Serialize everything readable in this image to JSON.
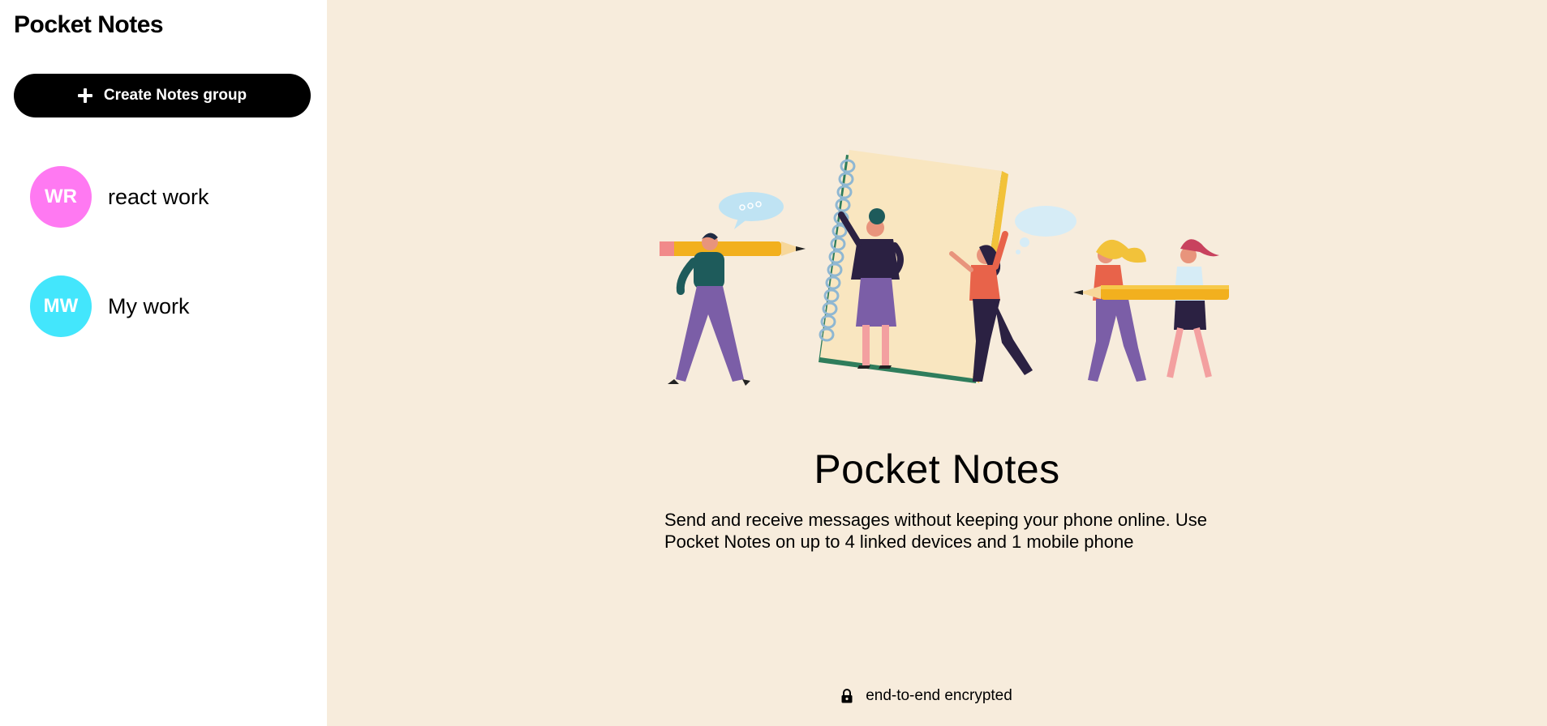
{
  "sidebar": {
    "title": "Pocket Notes",
    "create_button_label": "Create Notes group",
    "groups": [
      {
        "initials": "WR",
        "name": "react work",
        "color": "#ff79f2"
      },
      {
        "initials": "MW",
        "name": "My work",
        "color": "#43e6fc"
      }
    ]
  },
  "main": {
    "title": "Pocket Notes",
    "description": "Send and receive messages without keeping your phone online. Use Pocket Notes on up to 4 linked devices and 1 mobile phone",
    "footer": "end-to-end encrypted",
    "illustration": "people-with-pencils-and-notebook-illustration",
    "background_color": "#f7ecdc"
  },
  "icons": {
    "create": "plus-icon",
    "footer": "lock-icon"
  }
}
